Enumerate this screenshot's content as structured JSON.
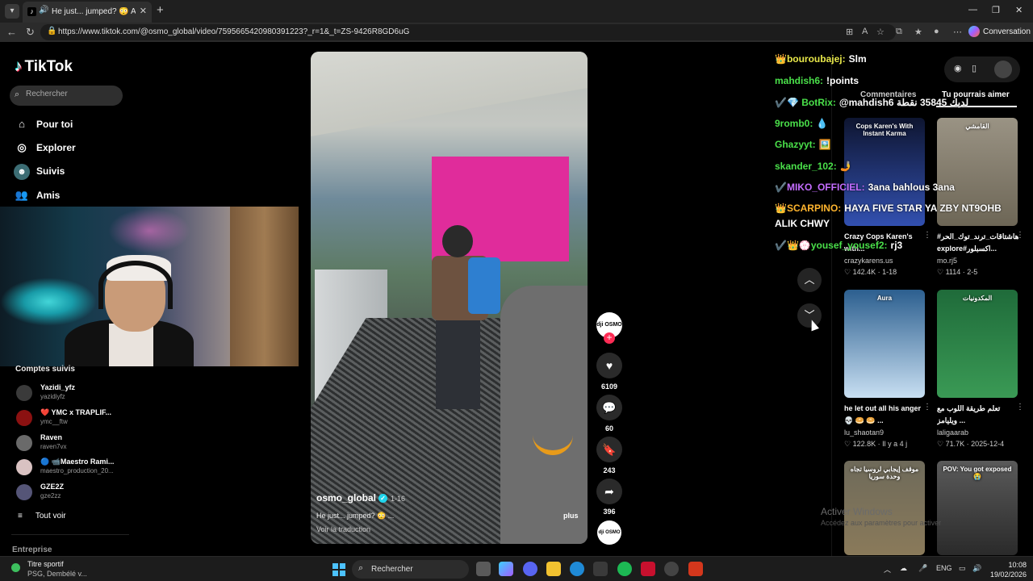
{
  "browser": {
    "tab_title": "He just... jumped? 😳 Anyway",
    "tab_favicon": "tiktok-icon",
    "url": "https://www.tiktok.com/@osmo_global/video/7595665420980391223?_r=1&_t=ZS-9426R8GD6uG",
    "copilot_label": "Conversation"
  },
  "sidebar": {
    "logo": "TikTok",
    "search_placeholder": "Rechercher",
    "nav": [
      {
        "label": "Pour toi",
        "icon": "home-icon"
      },
      {
        "label": "Explorer",
        "icon": "compass-icon"
      },
      {
        "label": "Suivis",
        "icon": "following-icon"
      },
      {
        "label": "Amis",
        "icon": "friends-icon"
      }
    ],
    "followed_title": "Comptes suivis",
    "accounts": [
      {
        "name": "Yazidi_yfz",
        "handle": "yazidiyfz",
        "color": "#3a3a3a"
      },
      {
        "name": "❤️ YMC x TRAPLIF...",
        "handle": "ymc__ftw",
        "color": "#8b1111"
      },
      {
        "name": "Raven",
        "handle": "raven7vx",
        "color": "#6a6a6a"
      },
      {
        "name": "🔵 📹Maestro Rami...",
        "handle": "maestro_production_20...",
        "color": "#d9c2c2"
      },
      {
        "name": "GZE2Z",
        "handle": "gze2zz",
        "color": "#555577"
      }
    ],
    "see_all": "Tout voir",
    "company": "Entreprise"
  },
  "video": {
    "author": "osmo_global",
    "date": "1-16",
    "description": "He just... jumped? 😳 ...",
    "translate": "Voir la traduction",
    "more": "plus",
    "avatar_label": "dji OSMO",
    "music_label": "dji OSMO",
    "likes": "6109",
    "comments": "60",
    "saves": "243",
    "shares": "396"
  },
  "chat": [
    {
      "user": "👑bouroubajej:",
      "msg": "Slm",
      "color": "#e8e84a"
    },
    {
      "user": "mahdish6:",
      "msg": "!points",
      "color": "#4ae04a"
    },
    {
      "user": "✔️💎 BotRix:",
      "msg": "@mahdish6 لديك 35845 نقطة",
      "color": "#4ae04a"
    },
    {
      "user": "9romb0:",
      "msg": "💧",
      "color": "#4ae04a"
    },
    {
      "user": "Ghazyyt:",
      "msg": "🖼️",
      "color": "#4ae04a"
    },
    {
      "user": "skander_102:",
      "msg": "🤳",
      "color": "#4ae04a"
    },
    {
      "user": "✔️MIKO_OFFICIEL:",
      "msg": "3ana bahlous 3ana",
      "color": "#c46dff"
    },
    {
      "user": "👑SCARPINO:",
      "msg": "HAYA FIVE STAR YA ZBY NT9OHB ALIK CHWY",
      "color": "#ffb52e"
    },
    {
      "user": "✔️👑💮yousef_yousef2:",
      "msg": "rj3",
      "color": "#4ae04a"
    }
  ],
  "right_panel": {
    "tab_comments": "Commentaires",
    "tab_suggest": "Tu pourrais aimer",
    "cards": [
      {
        "title": "Crazy Cops Karen's with...",
        "author": "crazykarens.us",
        "likes": "142.4K",
        "date": "1-18",
        "thumb_top": "#0e1530",
        "thumb_bottom": "#3250b0",
        "thumb_text": "Cops Karen's With Instant Karma"
      },
      {
        "title": "#هاشتاقات_ترند_توك_الحر explore#اكسبلور...",
        "author": "mo.rj5",
        "likes": "1114",
        "date": "2-5",
        "thumb_top": "#9a9384",
        "thumb_bottom": "#6d6656",
        "thumb_text": "القامشي"
      },
      {
        "title": "he let out all his anger💀 🥯 🥯 ...",
        "author": "lu_shaotan9",
        "likes": "122.8K",
        "date": "Il y a 4 j",
        "thumb_top": "#2c5f8f",
        "thumb_bottom": "#c8dff2",
        "thumb_text": "Aura"
      },
      {
        "title": "تعلم طريقة اللوب مع ويليامز ...",
        "author": "laligaarab",
        "likes": "71.7K",
        "date": "2025-12-4",
        "thumb_top": "#1f6b3a",
        "thumb_bottom": "#3a9a55",
        "thumb_text": "المكدونيات"
      },
      {
        "title": "",
        "author": "",
        "likes": "",
        "date": "",
        "thumb_top": "#6e6a5a",
        "thumb_bottom": "#8a7a5a",
        "thumb_text": "موقف إيجابي لروسيا تجاه وحدة سوريا"
      },
      {
        "title": "",
        "author": "",
        "likes": "",
        "date": "",
        "thumb_top": "#5a5a5a",
        "thumb_bottom": "#2a2a2a",
        "thumb_text": "POV: You got exposed 😭"
      }
    ]
  },
  "watermark": {
    "line1": "Activer Windows",
    "line2": "Accédez aux paramètres pour activer"
  },
  "taskbar": {
    "weather_title": "Titre sportif",
    "weather_sub": "PSG, Dembélé v...",
    "search": "Rechercher",
    "lang": "ENG",
    "time": "10:08",
    "date": "19/02/2026"
  },
  "colors": {
    "accent": "#fe2c55",
    "verified": "#20d5ec"
  }
}
